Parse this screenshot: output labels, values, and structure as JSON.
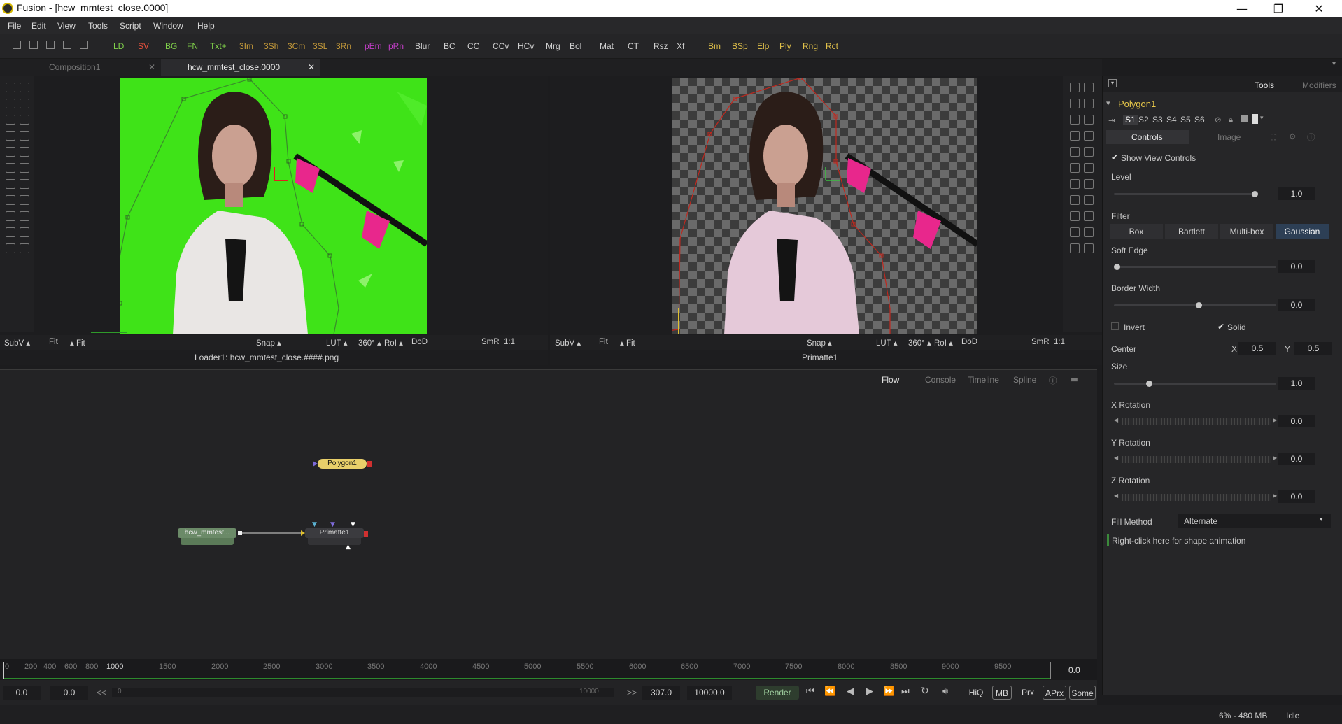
{
  "window": {
    "title": "Fusion - [hcw_mmtest_close.0000]",
    "min": "—",
    "max": "❐",
    "close": "✕"
  },
  "menu": [
    "File",
    "Edit",
    "View",
    "Tools",
    "Script",
    "Window",
    "Help"
  ],
  "toolbar": [
    {
      "label": "LD",
      "color": "#7fd04a"
    },
    {
      "label": "SV",
      "color": "#e8503c"
    },
    {
      "label": "BG",
      "color": "#7fd04a"
    },
    {
      "label": "FN",
      "color": "#7fd04a"
    },
    {
      "label": "Txt+",
      "color": "#7fd04a"
    },
    {
      "label": "3Im",
      "color": "#c59a3a"
    },
    {
      "label": "3Sh",
      "color": "#c59a3a"
    },
    {
      "label": "3Cm",
      "color": "#c59a3a"
    },
    {
      "label": "3SL",
      "color": "#c59a3a"
    },
    {
      "label": "3Rn",
      "color": "#c59a3a"
    },
    {
      "label": "pEm",
      "color": "#c23ec7"
    },
    {
      "label": "pRn",
      "color": "#c23ec7"
    },
    {
      "label": "Blur",
      "color": "#d0d0d0"
    },
    {
      "label": "BC",
      "color": "#d0d0d0"
    },
    {
      "label": "CC",
      "color": "#d0d0d0"
    },
    {
      "label": "CCv",
      "color": "#d0d0d0"
    },
    {
      "label": "HCv",
      "color": "#d0d0d0"
    },
    {
      "label": "Mrg",
      "color": "#d0d0d0"
    },
    {
      "label": "Bol",
      "color": "#d0d0d0"
    },
    {
      "label": "Mat",
      "color": "#d0d0d0"
    },
    {
      "label": "CT",
      "color": "#d0d0d0"
    },
    {
      "label": "Rsz",
      "color": "#d0d0d0"
    },
    {
      "label": "Xf",
      "color": "#d0d0d0"
    },
    {
      "label": "Bm",
      "color": "#e0c04a"
    },
    {
      "label": "BSp",
      "color": "#e0c04a"
    },
    {
      "label": "Elp",
      "color": "#e0c04a"
    },
    {
      "label": "Ply",
      "color": "#e0c04a"
    },
    {
      "label": "Rng",
      "color": "#e0c04a"
    },
    {
      "label": "Rct",
      "color": "#e0c04a"
    }
  ],
  "tabs": [
    {
      "label": "Composition1",
      "close": "✕"
    },
    {
      "label": "hcw_mmtest_close.0000",
      "close": "✕"
    }
  ],
  "viewer_bar": {
    "subv": "SubV ▴",
    "fit": "Fit",
    "fit2": "▴ Fit",
    "snap": "Snap ▴",
    "lut": "LUT ▴",
    "deg": "360° ▴",
    "roi": "RoI ▴",
    "dod": "DoD",
    "smr": "SmR",
    "ratio": "1:1"
  },
  "viewer1": {
    "caption": "Loader1: hcw_mmtest_close.####.png"
  },
  "viewer2": {
    "caption": "Primatte1"
  },
  "flow": {
    "tabs": [
      "Flow",
      "Console",
      "Timeline",
      "Spline"
    ],
    "nodes": {
      "polygon": "Polygon1",
      "loader": "hcw_mmtest...",
      "primatte": "Primatte1"
    }
  },
  "inspector": {
    "tabs": [
      "Tools",
      "Modifiers"
    ],
    "tool_name": "Polygon1",
    "shapes": [
      "S1",
      "S2",
      "S3",
      "S4",
      "S5",
      "S6"
    ],
    "subtabs": [
      "Controls",
      "Image"
    ],
    "show_view_controls": "Show View Controls",
    "level": {
      "label": "Level",
      "value": "1.0",
      "fraction": 1.0
    },
    "filter": {
      "label": "Filter",
      "options": [
        "Box",
        "Bartlett",
        "Multi-box",
        "Gaussian"
      ],
      "selected": "Gaussian"
    },
    "soft_edge": {
      "label": "Soft Edge",
      "value": "0.0",
      "fraction": 0.0
    },
    "border_width": {
      "label": "Border Width",
      "value": "0.0",
      "fraction": 0.5
    },
    "invert": "Invert",
    "solid": "Solid",
    "center": {
      "label": "Center",
      "x_label": "X",
      "x": "0.5",
      "y_label": "Y",
      "y": "0.5"
    },
    "size": {
      "label": "Size",
      "value": "1.0",
      "fraction": 0.2
    },
    "x_rotation": {
      "label": "X Rotation",
      "value": "0.0"
    },
    "y_rotation": {
      "label": "Y Rotation",
      "value": "0.0"
    },
    "z_rotation": {
      "label": "Z Rotation",
      "value": "0.0"
    },
    "fill_method": {
      "label": "Fill Method",
      "value": "Alternate"
    },
    "hint": "Right-click here for shape animation"
  },
  "timeline": {
    "ticks": [
      "0",
      "200",
      "400",
      "600",
      "800",
      "1000",
      "1500",
      "2000",
      "2500",
      "3000",
      "3500",
      "4000",
      "4500",
      "5000",
      "5500",
      "6000",
      "6500",
      "7000",
      "7500",
      "8000",
      "8500",
      "9000",
      "9500"
    ],
    "current": "0.0"
  },
  "transport": {
    "global_start": "0.0",
    "render_start": "0.0",
    "back": "<<",
    "slider_left": "0",
    "slider_right": "10000",
    "fwd": ">>",
    "render_end": "307.0",
    "global_end": "10000.0",
    "render": "Render",
    "hiq": "HiQ",
    "mb": "MB",
    "prx": "Prx",
    "aprx": "APrx",
    "some": "Some"
  },
  "status": {
    "memory": "6% - 480 MB",
    "state": "Idle"
  },
  "colors": {
    "accent": "#e8c84a",
    "green_screen": "#3fe318",
    "poly_red": "#c0281e"
  }
}
